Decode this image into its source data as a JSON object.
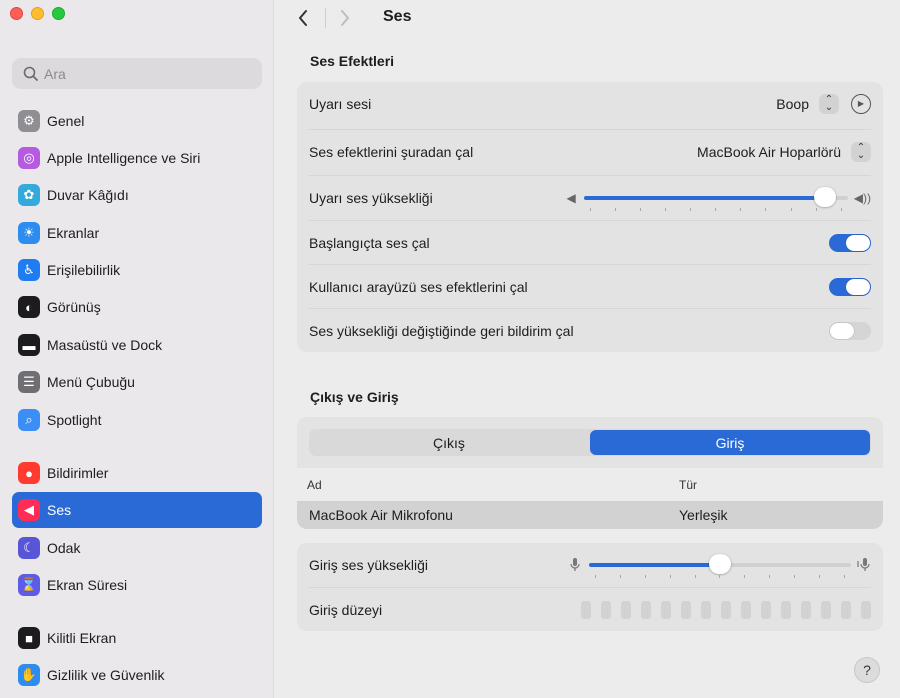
{
  "sidebar": {
    "search_placeholder": "Ara",
    "items": [
      {
        "label": "Genel",
        "icon": "gear-icon",
        "color": "#8e8e93"
      },
      {
        "label": "Apple Intelligence ve Siri",
        "icon": "siri-icon",
        "color": "#b45be0"
      },
      {
        "label": "Duvar Kâğıdı",
        "icon": "flower-icon",
        "color": "#34aadc"
      },
      {
        "label": "Ekranlar",
        "icon": "sun-icon",
        "color": "#2d8cf0"
      },
      {
        "label": "Erişilebilirlik",
        "icon": "accessibility-icon",
        "color": "#1f7cf2"
      },
      {
        "label": "Görünüş",
        "icon": "appearance-icon",
        "color": "#1c1c1e"
      },
      {
        "label": "Masaüstü ve Dock",
        "icon": "dock-icon",
        "color": "#1c1c1e"
      },
      {
        "label": "Menü Çubuğu",
        "icon": "menubar-icon",
        "color": "#6e6e73"
      },
      {
        "label": "Spotlight",
        "icon": "magnifier-icon",
        "color": "#3a8ef6"
      },
      {
        "label": "Bildirimler",
        "icon": "bell-icon",
        "color": "#ff3b30"
      },
      {
        "label": "Ses",
        "icon": "speaker-icon",
        "color": "#ff2d55"
      },
      {
        "label": "Odak",
        "icon": "moon-icon",
        "color": "#5856d6"
      },
      {
        "label": "Ekran Süresi",
        "icon": "hourglass-icon",
        "color": "#5e5ce6"
      },
      {
        "label": "Kilitli Ekran",
        "icon": "lock-icon",
        "color": "#1c1c1e"
      },
      {
        "label": "Gizlilik ve Güvenlik",
        "icon": "hand-icon",
        "color": "#2d8cf0"
      }
    ],
    "active_label": "Ses"
  },
  "header": {
    "title": "Ses"
  },
  "sound_effects": {
    "section_title": "Ses Efektleri",
    "alert_sound_label": "Uyarı sesi",
    "alert_sound_value": "Boop",
    "play_from_label": "Ses efektlerini şuradan çal",
    "play_from_value": "MacBook Air Hoparlörü",
    "alert_volume_label": "Uyarı ses yüksekliği",
    "alert_volume_level": 0.95,
    "startup_label": "Başlangıçta ses çal",
    "startup_on": true,
    "ui_effects_label": "Kullanıcı arayüzü ses efektlerini çal",
    "ui_effects_on": true,
    "volume_feedback_label": "Ses yüksekliği değiştiğinde geri bildirim çal",
    "volume_feedback_on": false
  },
  "io": {
    "section_title": "Çıkış ve Giriş",
    "tab_output": "Çıkış",
    "tab_input": "Giriş",
    "selected_tab": "Giriş",
    "col_name": "Ad",
    "col_type": "Tür",
    "devices": [
      {
        "name": "MacBook Air Mikrofonu",
        "type": "Yerleşik"
      }
    ],
    "input_volume_label": "Giriş ses yüksekliği",
    "input_volume_level": 0.5,
    "input_level_label": "Giriş düzeyi"
  },
  "help_label": "?"
}
